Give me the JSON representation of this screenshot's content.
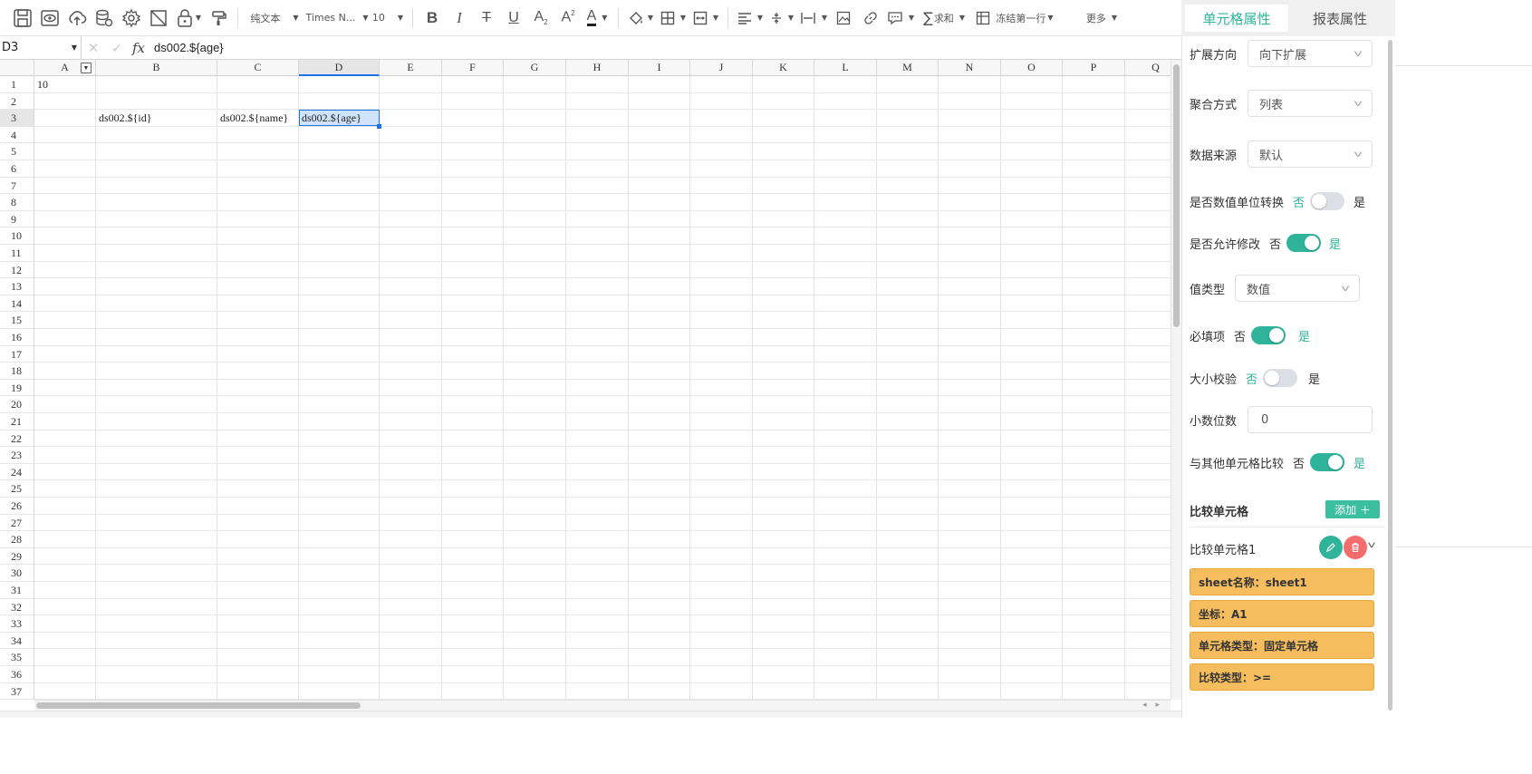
{
  "toolbar": {
    "format_label": "纯文本",
    "font_label": "Times N...",
    "size_label": "10",
    "sum_label": "求和",
    "freeze_label": "冻结第一行",
    "more_label": "更多"
  },
  "panel_tabs": {
    "cell_props": "单元格属性",
    "report_props": "报表属性"
  },
  "formula_bar": {
    "cell_ref": "D3",
    "cancel_glyph": "✕",
    "confirm_glyph": "✓",
    "fx": "fx",
    "value": "ds002.${age}"
  },
  "grid": {
    "columns": [
      "A",
      "B",
      "C",
      "D",
      "E",
      "F",
      "G",
      "H",
      "I",
      "J",
      "K",
      "L",
      "M",
      "N",
      "O",
      "P",
      "Q"
    ],
    "rows": [
      "1",
      "2",
      "3",
      "4",
      "5",
      "6",
      "7",
      "8",
      "9",
      "10",
      "11",
      "12",
      "13",
      "14",
      "15",
      "16",
      "17",
      "18",
      "19",
      "20",
      "21",
      "22",
      "23",
      "24",
      "25",
      "26",
      "27",
      "28",
      "29",
      "30",
      "31",
      "32",
      "33",
      "34",
      "35",
      "36",
      "37"
    ],
    "cells": {
      "A1": "10",
      "B3": "ds002.${id}",
      "C3": "ds002.${name}",
      "D3": "ds002.${age}"
    },
    "selected_column": "D",
    "selected_row": "3"
  },
  "panel": {
    "expand_direction": {
      "label": "扩展方向",
      "value": "向下扩展"
    },
    "aggregate": {
      "label": "聚合方式",
      "value": "列表"
    },
    "data_source": {
      "label": "数据来源",
      "value": "默认"
    },
    "unit_convert": {
      "label": "是否数值单位转换",
      "no": "否",
      "yes": "是",
      "on": false
    },
    "allow_edit": {
      "label": "是否允许修改",
      "no": "否",
      "yes": "是",
      "on": true
    },
    "value_type": {
      "label": "值类型",
      "value": "数值"
    },
    "required": {
      "label": "必填项",
      "no": "否",
      "yes": "是",
      "on": true
    },
    "size_check": {
      "label": "大小校验",
      "no": "否",
      "yes": "是",
      "on": false
    },
    "decimals": {
      "label": "小数位数",
      "value": "0"
    },
    "compare_other": {
      "label": "与其他单元格比较",
      "no": "否",
      "yes": "是",
      "on": true
    },
    "compare_section": {
      "title": "比较单元格",
      "add_label": "添加 ＋"
    },
    "compare_item": {
      "title": "比较单元格1",
      "tags": [
        "sheet名称：sheet1",
        "坐标：A1",
        "单元格类型：固定单元格",
        "比较类型：>="
      ]
    }
  }
}
